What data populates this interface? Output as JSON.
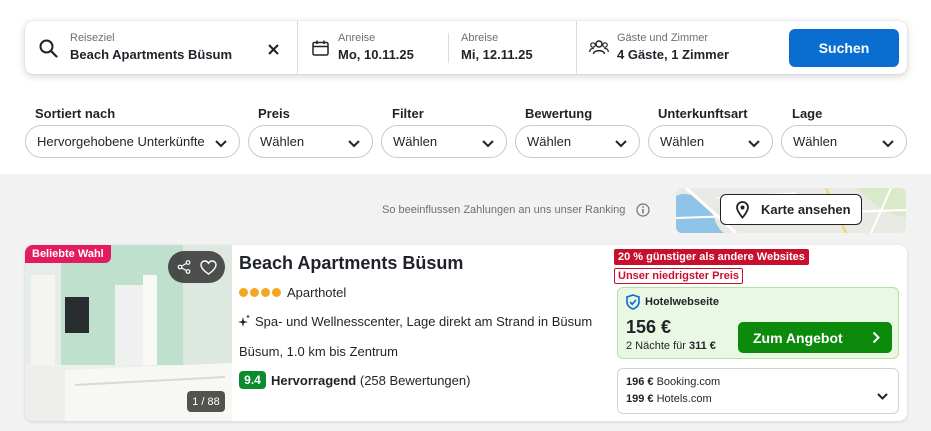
{
  "search": {
    "destination_label": "Reiseziel",
    "destination_value": "Beach Apartments Büsum",
    "checkin_label": "Anreise",
    "checkin_value": "Mo, 10.11.25",
    "checkout_label": "Abreise",
    "checkout_value": "Mi, 12.11.25",
    "guests_label": "Gäste und Zimmer",
    "guests_value": "4 Gäste, 1 Zimmer",
    "search_button": "Suchen"
  },
  "filters": [
    {
      "label": "Sortiert nach",
      "value": "Hervorgehobene Unterkünfte"
    },
    {
      "label": "Preis",
      "value": "Wählen"
    },
    {
      "label": "Filter",
      "value": "Wählen"
    },
    {
      "label": "Bewertung",
      "value": "Wählen"
    },
    {
      "label": "Unterkunftsart",
      "value": "Wählen"
    },
    {
      "label": "Lage",
      "value": "Wählen"
    }
  ],
  "ranking_note": "So beeinflussen Zahlungen an uns unser Ranking",
  "map_button": "Karte ansehen",
  "colors": {
    "primary": "#0a6ed1",
    "deal_green": "#0b8a0b",
    "score_green": "#0b8a2e",
    "badge_red": "#c8102e",
    "popular_pink": "#e31c5f",
    "star_orange": "#f5a623"
  },
  "hotel": {
    "badge": "Beliebte Wahl",
    "photo_counter": "1 / 88",
    "name": "Beach Apartments Büsum",
    "stars": 4,
    "type": "Aparthotel",
    "features": "Spa- und Wellnesscenter, Lage direkt am Strand in Büsum",
    "location": "Büsum, 1.0 km bis Zentrum",
    "score": "9.4",
    "rating_word": "Hervorragend",
    "rating_count": "(258 Bewertungen)",
    "deal_badge": "20 % günstiger als andere Websites",
    "lowest_badge": "Unser niedrigster Preis",
    "offer": {
      "site": "Hotelwebseite",
      "price": "156 €",
      "nights_text": "2 Nächte für",
      "total": "311 €",
      "button": "Zum Angebot"
    },
    "other_offers": [
      {
        "price": "196 €",
        "site": "Booking.com"
      },
      {
        "price": "199 €",
        "site": "Hotels.com"
      }
    ]
  },
  "icons": [
    "search-icon",
    "close-icon",
    "calendar-icon",
    "guests-icon",
    "chevron-down-icon",
    "info-icon",
    "map-pin-icon",
    "share-icon",
    "heart-icon",
    "sparkle-icon",
    "shield-check-icon",
    "chevron-right-icon"
  ]
}
